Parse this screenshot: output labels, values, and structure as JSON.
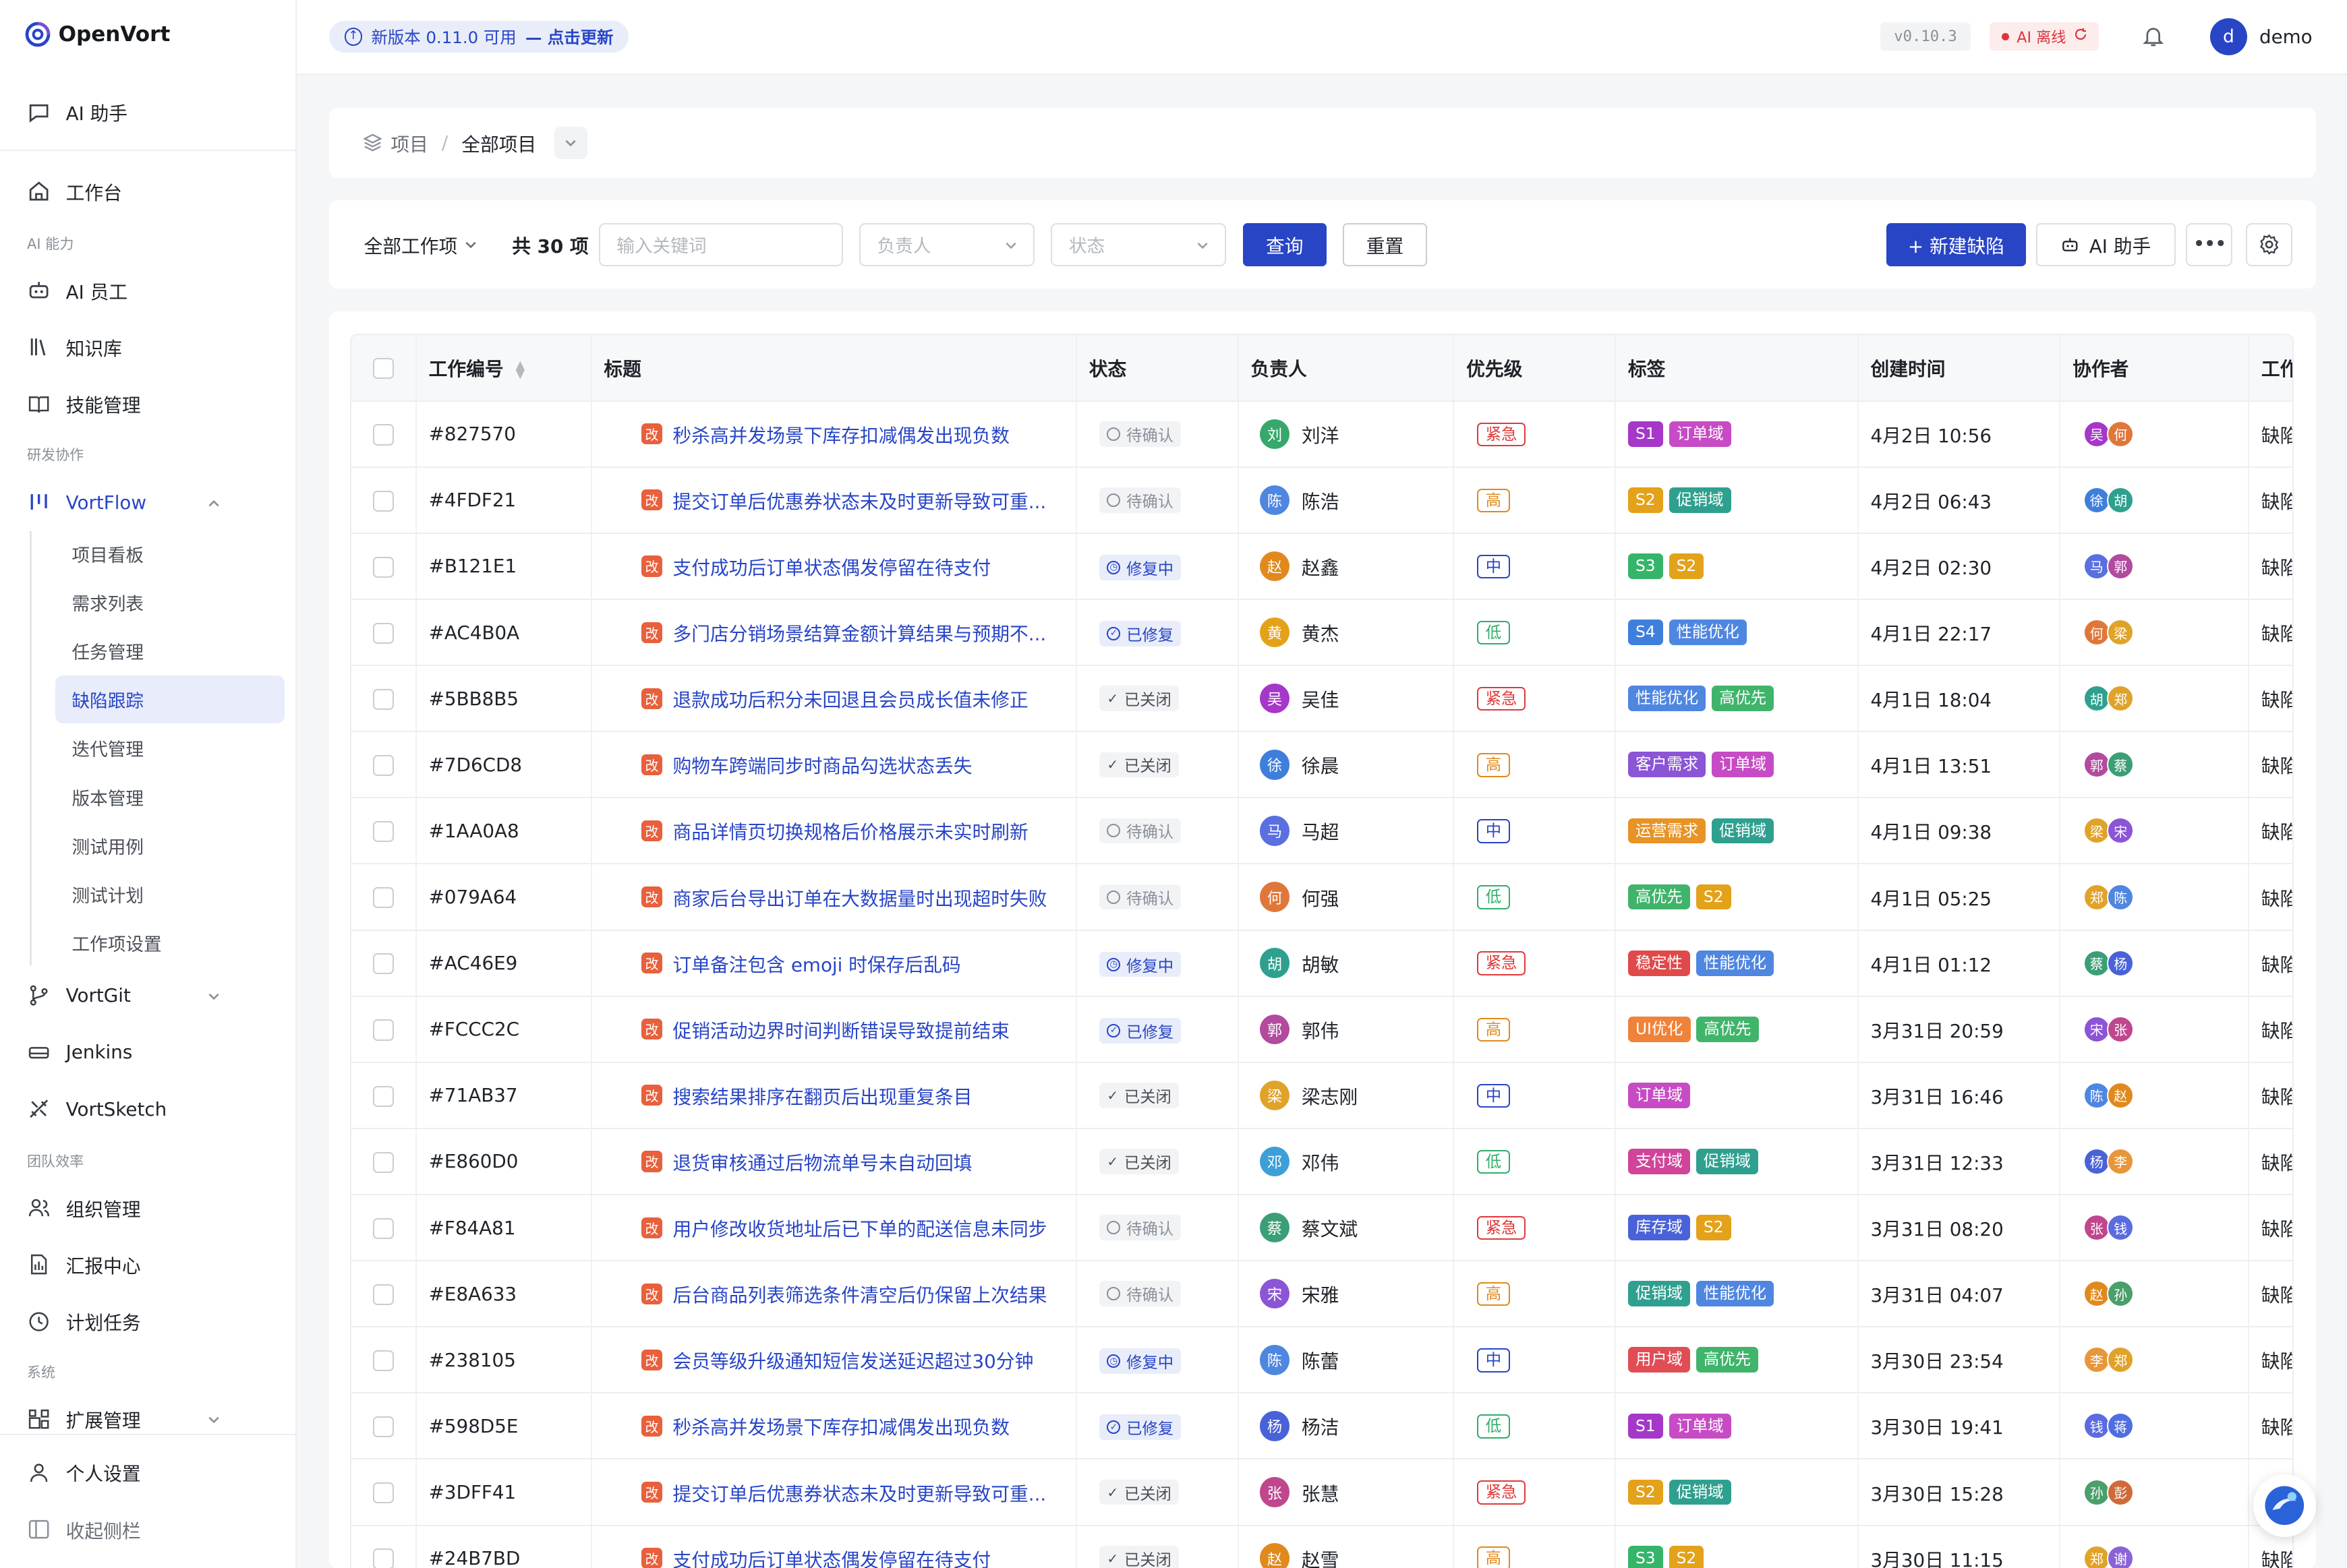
{
  "brand": {
    "name": "OpenVort"
  },
  "sidebar": {
    "ai_assistant": "AI 助手",
    "workbench": "工作台",
    "section_ai": "AI 能力",
    "ai_staff": "AI 员工",
    "knowledge": "知识库",
    "skills": "技能管理",
    "section_dev": "研发协作",
    "vortflow": "VortFlow",
    "vortflow_items": [
      "项目看板",
      "需求列表",
      "任务管理",
      "缺陷跟踪",
      "迭代管理",
      "版本管理",
      "测试用例",
      "测试计划",
      "工作项设置"
    ],
    "vortgit": "VortGit",
    "jenkins": "Jenkins",
    "vortsketch": "VortSketch",
    "section_team": "团队效率",
    "org": "组织管理",
    "reports": "汇报中心",
    "schedule": "计划任务",
    "section_system": "系统",
    "extensions": "扩展管理",
    "personal": "个人设置",
    "collapse": "收起侧栏"
  },
  "topbar": {
    "update_text": "新版本 0.11.0 可用",
    "update_link": "— 点击更新",
    "version": "v0.10.3",
    "ai_status": "AI 离线",
    "user_initial": "d",
    "user_name": "demo"
  },
  "breadcrumb": {
    "root": "项目",
    "current": "全部项目"
  },
  "toolbar": {
    "scope": "全部工作项",
    "count": "共 30 项",
    "keyword_placeholder": "输入关键词",
    "assignee_placeholder": "负责人",
    "status_placeholder": "状态",
    "query": "查询",
    "reset": "重置",
    "new_bug": "+ 新建缺陷",
    "ai_assistant": "AI 助手"
  },
  "table": {
    "columns": [
      "工作编号",
      "标题",
      "状态",
      "负责人",
      "优先级",
      "标签",
      "创建时间",
      "协作者",
      "工作"
    ],
    "bug_icon": "改",
    "type_text": "缺陷",
    "rows": [
      {
        "id": "#827570",
        "title": "秒杀高并发场景下库存扣减偶发出现负数",
        "status": "待确认",
        "assignee": "刘洋",
        "av": "刘",
        "priority": "紧急",
        "tags": [
          "S1",
          "订单域"
        ],
        "created": "4月2日 10:56",
        "collab": [
          "吴",
          "何"
        ]
      },
      {
        "id": "#4FDF21",
        "title": "提交订单后优惠券状态未及时更新导致可重...",
        "status": "待确认",
        "assignee": "陈浩",
        "av": "陈",
        "priority": "高",
        "tags": [
          "S2",
          "促销域"
        ],
        "created": "4月2日 06:43",
        "collab": [
          "徐",
          "胡"
        ]
      },
      {
        "id": "#B121E1",
        "title": "支付成功后订单状态偶发停留在待支付",
        "status": "修复中",
        "assignee": "赵鑫",
        "av": "赵",
        "priority": "中",
        "tags": [
          "S3",
          "S2"
        ],
        "created": "4月2日 02:30",
        "collab": [
          "马",
          "郭"
        ]
      },
      {
        "id": "#AC4B0A",
        "title": "多门店分销场景结算金额计算结果与预期不...",
        "status": "已修复",
        "assignee": "黄杰",
        "av": "黄",
        "priority": "低",
        "tags": [
          "S4",
          "性能优化"
        ],
        "created": "4月1日 22:17",
        "collab": [
          "何",
          "梁"
        ]
      },
      {
        "id": "#5BB8B5",
        "title": "退款成功后积分未回退且会员成长值未修正",
        "status": "已关闭",
        "assignee": "吴佳",
        "av": "吴",
        "priority": "紧急",
        "tags": [
          "性能优化",
          "高优先"
        ],
        "created": "4月1日 18:04",
        "collab": [
          "胡",
          "郑"
        ]
      },
      {
        "id": "#7D6CD8",
        "title": "购物车跨端同步时商品勾选状态丢失",
        "status": "已关闭",
        "assignee": "徐晨",
        "av": "徐",
        "priority": "高",
        "tags": [
          "客户需求",
          "订单域"
        ],
        "created": "4月1日 13:51",
        "collab": [
          "郭",
          "蔡"
        ]
      },
      {
        "id": "#1AA0A8",
        "title": "商品详情页切换规格后价格展示未实时刷新",
        "status": "待确认",
        "assignee": "马超",
        "av": "马",
        "priority": "中",
        "tags": [
          "运营需求",
          "促销域"
        ],
        "created": "4月1日 09:38",
        "collab": [
          "梁",
          "宋"
        ]
      },
      {
        "id": "#079A64",
        "title": "商家后台导出订单在大数据量时出现超时失败",
        "status": "待确认",
        "assignee": "何强",
        "av": "何",
        "priority": "低",
        "tags": [
          "高优先",
          "S2"
        ],
        "created": "4月1日 05:25",
        "collab": [
          "郑",
          "陈"
        ]
      },
      {
        "id": "#AC46E9",
        "title": "订单备注包含 emoji 时保存后乱码",
        "status": "修复中",
        "assignee": "胡敏",
        "av": "胡",
        "priority": "紧急",
        "tags": [
          "稳定性",
          "性能优化"
        ],
        "created": "4月1日 01:12",
        "collab": [
          "蔡",
          "杨"
        ]
      },
      {
        "id": "#FCCC2C",
        "title": "促销活动边界时间判断错误导致提前结束",
        "status": "已修复",
        "assignee": "郭伟",
        "av": "郭",
        "priority": "高",
        "tags": [
          "UI优化",
          "高优先"
        ],
        "created": "3月31日 20:59",
        "collab": [
          "宋",
          "张"
        ]
      },
      {
        "id": "#71AB37",
        "title": "搜索结果排序在翻页后出现重复条目",
        "status": "已关闭",
        "assignee": "梁志刚",
        "av": "梁",
        "priority": "中",
        "tags": [
          "订单域"
        ],
        "created": "3月31日 16:46",
        "collab": [
          "陈",
          "赵"
        ]
      },
      {
        "id": "#E860D0",
        "title": "退货审核通过后物流单号未自动回填",
        "status": "已关闭",
        "assignee": "邓伟",
        "av": "邓",
        "priority": "低",
        "tags": [
          "支付域",
          "促销域"
        ],
        "created": "3月31日 12:33",
        "collab": [
          "杨",
          "李"
        ]
      },
      {
        "id": "#F84A81",
        "title": "用户修改收货地址后已下单的配送信息未同步",
        "status": "待确认",
        "assignee": "蔡文斌",
        "av": "蔡",
        "priority": "紧急",
        "tags": [
          "库存域",
          "S2"
        ],
        "created": "3月31日 08:20",
        "collab": [
          "张",
          "钱"
        ]
      },
      {
        "id": "#E8A633",
        "title": "后台商品列表筛选条件清空后仍保留上次结果",
        "status": "待确认",
        "assignee": "宋雅",
        "av": "宋",
        "priority": "高",
        "tags": [
          "促销域",
          "性能优化"
        ],
        "created": "3月31日 04:07",
        "collab": [
          "赵",
          "孙"
        ]
      },
      {
        "id": "#238105",
        "title": "会员等级升级通知短信发送延迟超过30分钟",
        "status": "修复中",
        "assignee": "陈蕾",
        "av": "陈",
        "priority": "中",
        "tags": [
          "用户域",
          "高优先"
        ],
        "created": "3月30日 23:54",
        "collab": [
          "李",
          "郑"
        ]
      },
      {
        "id": "#598D5E",
        "title": "秒杀高并发场景下库存扣减偶发出现负数",
        "status": "已修复",
        "assignee": "杨洁",
        "av": "杨",
        "priority": "低",
        "tags": [
          "S1",
          "订单域"
        ],
        "created": "3月30日 19:41",
        "collab": [
          "钱",
          "蒋"
        ]
      },
      {
        "id": "#3DFF41",
        "title": "提交订单后优惠券状态未及时更新导致可重...",
        "status": "已关闭",
        "assignee": "张慧",
        "av": "张",
        "priority": "紧急",
        "tags": [
          "S2",
          "促销域"
        ],
        "created": "3月30日 15:28",
        "collab": [
          "孙",
          "彭"
        ]
      },
      {
        "id": "#24B7BD",
        "title": "支付成功后订单状态偶发停留在待支付",
        "status": "已关闭",
        "assignee": "赵雪",
        "av": "赵",
        "priority": "高",
        "tags": [
          "S3",
          "S2"
        ],
        "created": "3月30日 11:15",
        "collab": [
          "郑",
          "谢"
        ]
      }
    ]
  },
  "colors": {
    "primary": "#2845c6",
    "priority": {
      "紧急": "#e03a3a",
      "高": "#e08a1e",
      "中": "#2845c6",
      "低": "#2fae6a"
    },
    "tags": {
      "S1": "#a537c9",
      "S2": "#e3a21a",
      "S3": "#36b56a",
      "S4": "#3f7fdc",
      "订单域": "#c74bc4",
      "促销域": "#2fa08f",
      "性能优化": "#4f86e0",
      "高优先": "#40b46b",
      "客户需求": "#8b55d6",
      "运营需求": "#e79325",
      "稳定性": "#e0494a",
      "UI优化": "#f0833a",
      "支付域": "#d0449a",
      "库存域": "#4a62d8",
      "用户域": "#e14d55"
    },
    "avatars": {
      "刘": "#36a86b",
      "陈": "#4f86e0",
      "赵": "#e08a1e",
      "黄": "#e3a21a",
      "吴": "#a537c9",
      "徐": "#3f7fdc",
      "马": "#5a6fe0",
      "何": "#e0773a",
      "胡": "#2fa08f",
      "郭": "#b24a9e",
      "梁": "#e0a32a",
      "邓": "#3c9fd8",
      "蔡": "#3a9f76",
      "宋": "#8b55d6",
      "杨": "#4a62d8",
      "张": "#c0468d",
      "李": "#e8963a",
      "郑": "#e0a32a",
      "钱": "#5b6be0",
      "孙": "#4a9f6a",
      "蒋": "#4f6fe0",
      "彭": "#d06a3a",
      "谢": "#8c63d6"
    }
  }
}
